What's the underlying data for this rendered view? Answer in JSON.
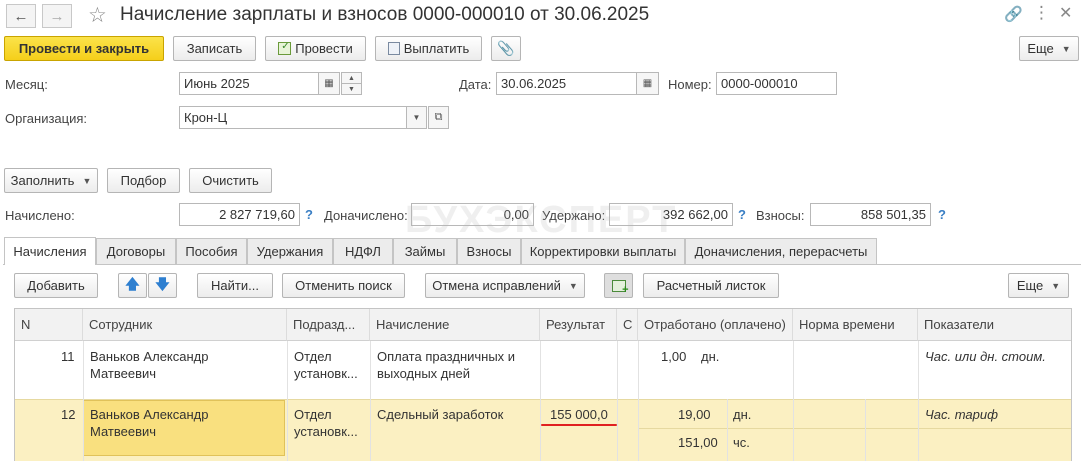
{
  "window": {
    "title": "Начисление зарплаты и взносов 0000-000010 от 30.06.2025"
  },
  "toolbar": {
    "post_close": "Провести и закрыть",
    "save": "Записать",
    "post": "Провести",
    "pay": "Выплатить",
    "more": "Еще"
  },
  "header": {
    "month_label": "Месяц:",
    "month_value": "Июнь 2025",
    "date_label": "Дата:",
    "date_value": "30.06.2025",
    "number_label": "Номер:",
    "number_value": "0000-000010",
    "org_label": "Организация:",
    "org_value": "Крон-Ц"
  },
  "actions": {
    "fill": "Заполнить",
    "select": "Подбор",
    "clear": "Очистить"
  },
  "totals": {
    "accrued_label": "Начислено:",
    "accrued_value": "2 827 719,60",
    "additional_label": "Доначислено:",
    "additional_value": "0,00",
    "withheld_label": "Удержано:",
    "withheld_value": "392 662,00",
    "contributions_label": "Взносы:",
    "contributions_value": "858 501,35",
    "help_mark": "?"
  },
  "watermark": "БУХЭКСПЕРТ",
  "tabs": [
    {
      "label": "Начисления"
    },
    {
      "label": "Договоры"
    },
    {
      "label": "Пособия"
    },
    {
      "label": "Удержания"
    },
    {
      "label": "НДФЛ"
    },
    {
      "label": "Займы"
    },
    {
      "label": "Взносы"
    },
    {
      "label": "Корректировки выплаты"
    },
    {
      "label": "Доначисления, перерасчеты"
    }
  ],
  "table_toolbar": {
    "add": "Добавить",
    "find": "Найти...",
    "cancel_search": "Отменить поиск",
    "cancel_fixes": "Отмена исправлений",
    "payslip": "Расчетный листок",
    "more": "Еще"
  },
  "table": {
    "columns": [
      "N",
      "Сотрудник",
      "Подразд...",
      "Начисление",
      "Результат",
      "С",
      "Отработано (оплачено)",
      "Норма времени",
      "Показатели"
    ],
    "rows": [
      {
        "n": "11",
        "employee_line1": "Ваньков Александр",
        "employee_line2": "Матвеевич",
        "dept_line1": "Отдел",
        "dept_line2": "установк...",
        "accrual_line1": "Оплата праздничных и",
        "accrual_line2": "выходных дней",
        "result": "",
        "worked": "1,00",
        "worked_unit": "дн.",
        "worked2": "",
        "worked2_unit": "",
        "indicators": "Час. или дн. стоим."
      },
      {
        "n": "12",
        "employee_line1": "Ваньков Александр",
        "employee_line2": "Матвеевич",
        "dept_line1": "Отдел",
        "dept_line2": "установк...",
        "accrual_line1": "Сдельный заработок",
        "accrual_line2": "",
        "result": "155 000,0",
        "worked": "19,00",
        "worked_unit": "дн.",
        "worked2": "151,00",
        "worked2_unit": "чс.",
        "indicators": "Час. тариф"
      }
    ]
  },
  "colors": {
    "primary_button": "#f5cf1a",
    "selected_row": "#fbf0c2",
    "selected_cell": "#f9e07f",
    "underline": "#e02020",
    "help": "#3a7fc4"
  }
}
